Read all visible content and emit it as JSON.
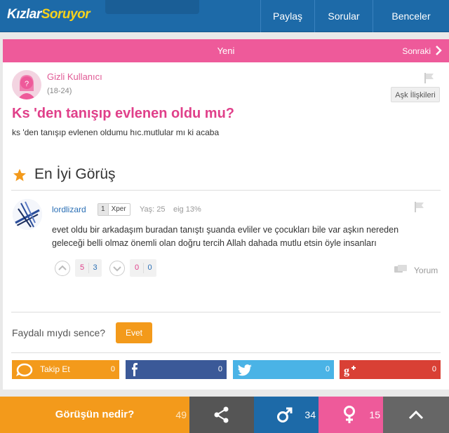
{
  "nav": {
    "logo_part1": "Kızlar",
    "logo_part2": "Soruyor",
    "items": [
      {
        "label": "Paylaş"
      },
      {
        "label": "Sorular"
      },
      {
        "label": "Benceler"
      }
    ]
  },
  "question_header": {
    "tab_label": "Yeni",
    "next_label": "Sonraki"
  },
  "question": {
    "author": "Gizli Kullanıcı",
    "age": "(18-24)",
    "category": "Aşk İlişkileri",
    "title": "Ks 'den tanışıp evlenen oldu mu?",
    "body": "ks 'den tanışıp evlenen oldumu hıc.mutlular mı ki acaba"
  },
  "best_answer": {
    "heading": "En İyi Görüş",
    "author": "lordlizard",
    "xper_level": "1",
    "xper_label": "Xper",
    "age": "Yaş: 25",
    "eig": "eig 13%",
    "body": "evet oldu bir arkadaşım buradan tanıştı şuanda evliler ve çocukları bile var aşkın nereden geleceği belli olmaz önemli olan doğru tercih Allah dahada mutlu etsin öyle insanları",
    "upvotes_female": "5",
    "upvotes_male": "3",
    "downvotes_female": "0",
    "downvotes_male": "0",
    "comment_label": "Yorum"
  },
  "feedback": {
    "question": "Faydalı mıydı sence?",
    "yes_label": "Evet"
  },
  "share": {
    "follow_label": "Takip Et",
    "follow_count": "0",
    "facebook_count": "0",
    "twitter_count": "0",
    "googleplus_count": "0"
  },
  "bottom_bar": {
    "opinion_label": "Görüşün nedir?",
    "opinion_count": "49",
    "male_count": "34",
    "female_count": "15"
  },
  "colors": {
    "nav_blue": "#1d6aa8",
    "pink": "#ee5a9a",
    "orange": "#f39a1b",
    "facebook": "#3b5998",
    "twitter": "#4ab3e6",
    "googleplus": "#d94035"
  },
  "icons": [
    "chevron-right-icon",
    "female-avatar-icon",
    "flag-icon",
    "star-icon",
    "vote-up-icon",
    "vote-down-icon",
    "comment-icon",
    "follow-icon",
    "facebook-icon",
    "twitter-icon",
    "googleplus-icon",
    "share-icon",
    "male-icon",
    "female-icon",
    "chevron-up-icon"
  ]
}
